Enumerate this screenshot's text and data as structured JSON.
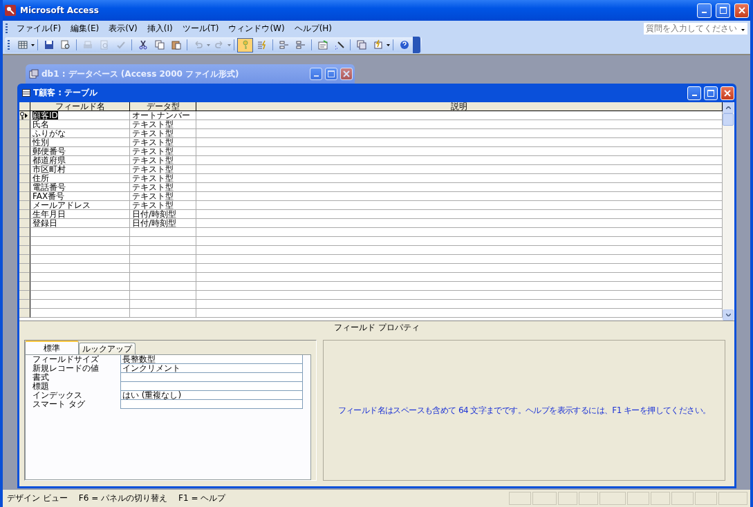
{
  "window": {
    "title": "Microsoft Access"
  },
  "menu": [
    "ファイル(F)",
    "編集(E)",
    "表示(V)",
    "挿入(I)",
    "ツール(T)",
    "ウィンドウ(W)",
    "ヘルプ(H)"
  ],
  "help_search": {
    "placeholder": "質問を入力してください"
  },
  "toolbar": [
    {
      "kind": "view",
      "disabled": false,
      "pressed": false
    },
    {
      "kind": "separator"
    },
    {
      "kind": "save",
      "disabled": false,
      "pressed": false
    },
    {
      "kind": "search",
      "disabled": false,
      "pressed": false
    },
    {
      "kind": "separator"
    },
    {
      "kind": "print",
      "disabled": true,
      "pressed": false
    },
    {
      "kind": "preview",
      "disabled": true,
      "pressed": false
    },
    {
      "kind": "spell",
      "disabled": true,
      "pressed": false
    },
    {
      "kind": "separator"
    },
    {
      "kind": "cut",
      "disabled": false,
      "pressed": false
    },
    {
      "kind": "copy",
      "disabled": false,
      "pressed": false
    },
    {
      "kind": "paste",
      "disabled": false,
      "pressed": false
    },
    {
      "kind": "separator"
    },
    {
      "kind": "undo",
      "disabled": true,
      "pressed": false
    },
    {
      "kind": "redo",
      "disabled": true,
      "pressed": false
    },
    {
      "kind": "separator"
    },
    {
      "kind": "key",
      "disabled": false,
      "pressed": true
    },
    {
      "kind": "lightning",
      "disabled": false,
      "pressed": false
    },
    {
      "kind": "separator"
    },
    {
      "kind": "insert-row",
      "disabled": false,
      "pressed": false
    },
    {
      "kind": "delete-row",
      "disabled": false,
      "pressed": false
    },
    {
      "kind": "separator"
    },
    {
      "kind": "properties",
      "disabled": false,
      "pressed": false
    },
    {
      "kind": "wand",
      "disabled": false,
      "pressed": false
    },
    {
      "kind": "separator"
    },
    {
      "kind": "db-window",
      "disabled": false,
      "pressed": false
    },
    {
      "kind": "new-object",
      "disabled": false,
      "pressed": false
    },
    {
      "kind": "separator"
    },
    {
      "kind": "help",
      "disabled": false,
      "pressed": false
    }
  ],
  "database_window": {
    "title": "db1 : データベース (Access 2000 ファイル形式)"
  },
  "table_window": {
    "title": "T顧客 : テーブル"
  },
  "design_grid": {
    "columns": [
      "フィールド名",
      "データ型",
      "説明"
    ],
    "rows": [
      {
        "field": "顧客ID",
        "type": "オートナンバー",
        "primary_key": true,
        "selected": true
      },
      {
        "field": "氏名",
        "type": "テキスト型",
        "primary_key": false,
        "selected": false
      },
      {
        "field": "ふりがな",
        "type": "テキスト型",
        "primary_key": false,
        "selected": false
      },
      {
        "field": "性別",
        "type": "テキスト型",
        "primary_key": false,
        "selected": false
      },
      {
        "field": "郵便番号",
        "type": "テキスト型",
        "primary_key": false,
        "selected": false
      },
      {
        "field": "都道府県",
        "type": "テキスト型",
        "primary_key": false,
        "selected": false
      },
      {
        "field": "市区町村",
        "type": "テキスト型",
        "primary_key": false,
        "selected": false
      },
      {
        "field": "住所",
        "type": "テキスト型",
        "primary_key": false,
        "selected": false
      },
      {
        "field": "電話番号",
        "type": "テキスト型",
        "primary_key": false,
        "selected": false
      },
      {
        "field": "FAX番号",
        "type": "テキスト型",
        "primary_key": false,
        "selected": false
      },
      {
        "field": "メールアドレス",
        "type": "テキスト型",
        "primary_key": false,
        "selected": false
      },
      {
        "field": "生年月日",
        "type": "日付/時刻型",
        "primary_key": false,
        "selected": false
      },
      {
        "field": "登録日",
        "type": "日付/時刻型",
        "primary_key": false,
        "selected": false
      }
    ]
  },
  "field_properties": {
    "title": "フィールド プロパティ",
    "tabs": [
      {
        "label": "標準",
        "selected": true
      },
      {
        "label": "ルックアップ",
        "selected": false
      }
    ],
    "properties": [
      {
        "label": "フィールドサイズ",
        "value": "長整数型"
      },
      {
        "label": "新規レコードの値",
        "value": "インクリメント"
      },
      {
        "label": "書式"
      },
      {
        "label": "標題"
      },
      {
        "label": "インデックス",
        "value": "はい (重複なし)"
      },
      {
        "label": "スマート タグ"
      }
    ],
    "help_text": "フィールド名はスペースも含めて 64 文字までです。ヘルプを表示するには、F1 キーを押してください。"
  },
  "status_bar": [
    "デザイン ビュー",
    "F6 = パネルの切り替え",
    "F1 = ヘルプ"
  ]
}
